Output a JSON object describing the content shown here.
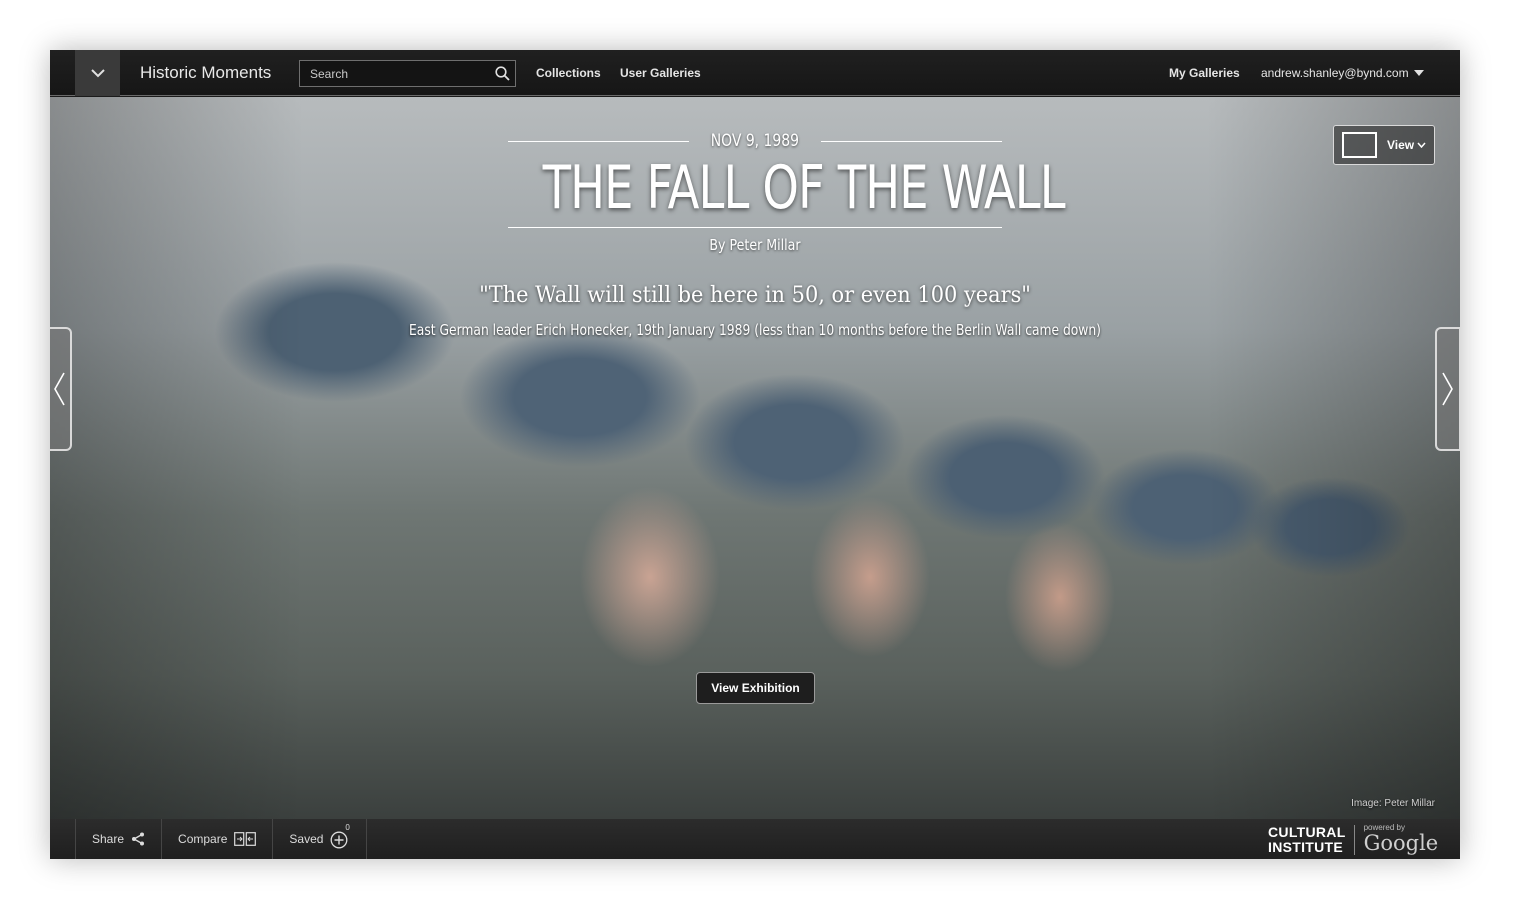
{
  "header": {
    "app_title": "Historic Moments",
    "search_placeholder": "Search",
    "nav": [
      "Collections",
      "User Galleries"
    ],
    "my_galleries": "My Galleries",
    "account_email": "andrew.shanley@bynd.com"
  },
  "hero": {
    "date": "NOV 9, 1989",
    "headline": "THE FALL OF THE WALL",
    "byline": "By Peter Millar",
    "quote": "\"The Wall will still be here in 50, or even 100 years\"",
    "attribution": "East German leader Erich Honecker, 19th January 1989 (less than 10 months before the Berlin Wall came down)",
    "view_label": "View",
    "view_exhibition_label": "View Exhibition",
    "image_credit": "Image: Peter Millar"
  },
  "footer": {
    "share_label": "Share",
    "compare_label": "Compare",
    "saved_label": "Saved",
    "saved_count": "0",
    "logo_line1": "CULTURAL",
    "logo_line2": "INSTITUTE",
    "powered_by": "powered by",
    "google": "Google"
  },
  "icons": {
    "menu": "chevron-down-icon",
    "search": "search-icon",
    "account": "caret-down-icon",
    "view": "chevron-down-icon",
    "prev": "chevron-left-icon",
    "next": "chevron-right-icon",
    "share": "share-icon",
    "compare": "compare-icon",
    "saved": "add-circle-icon"
  }
}
